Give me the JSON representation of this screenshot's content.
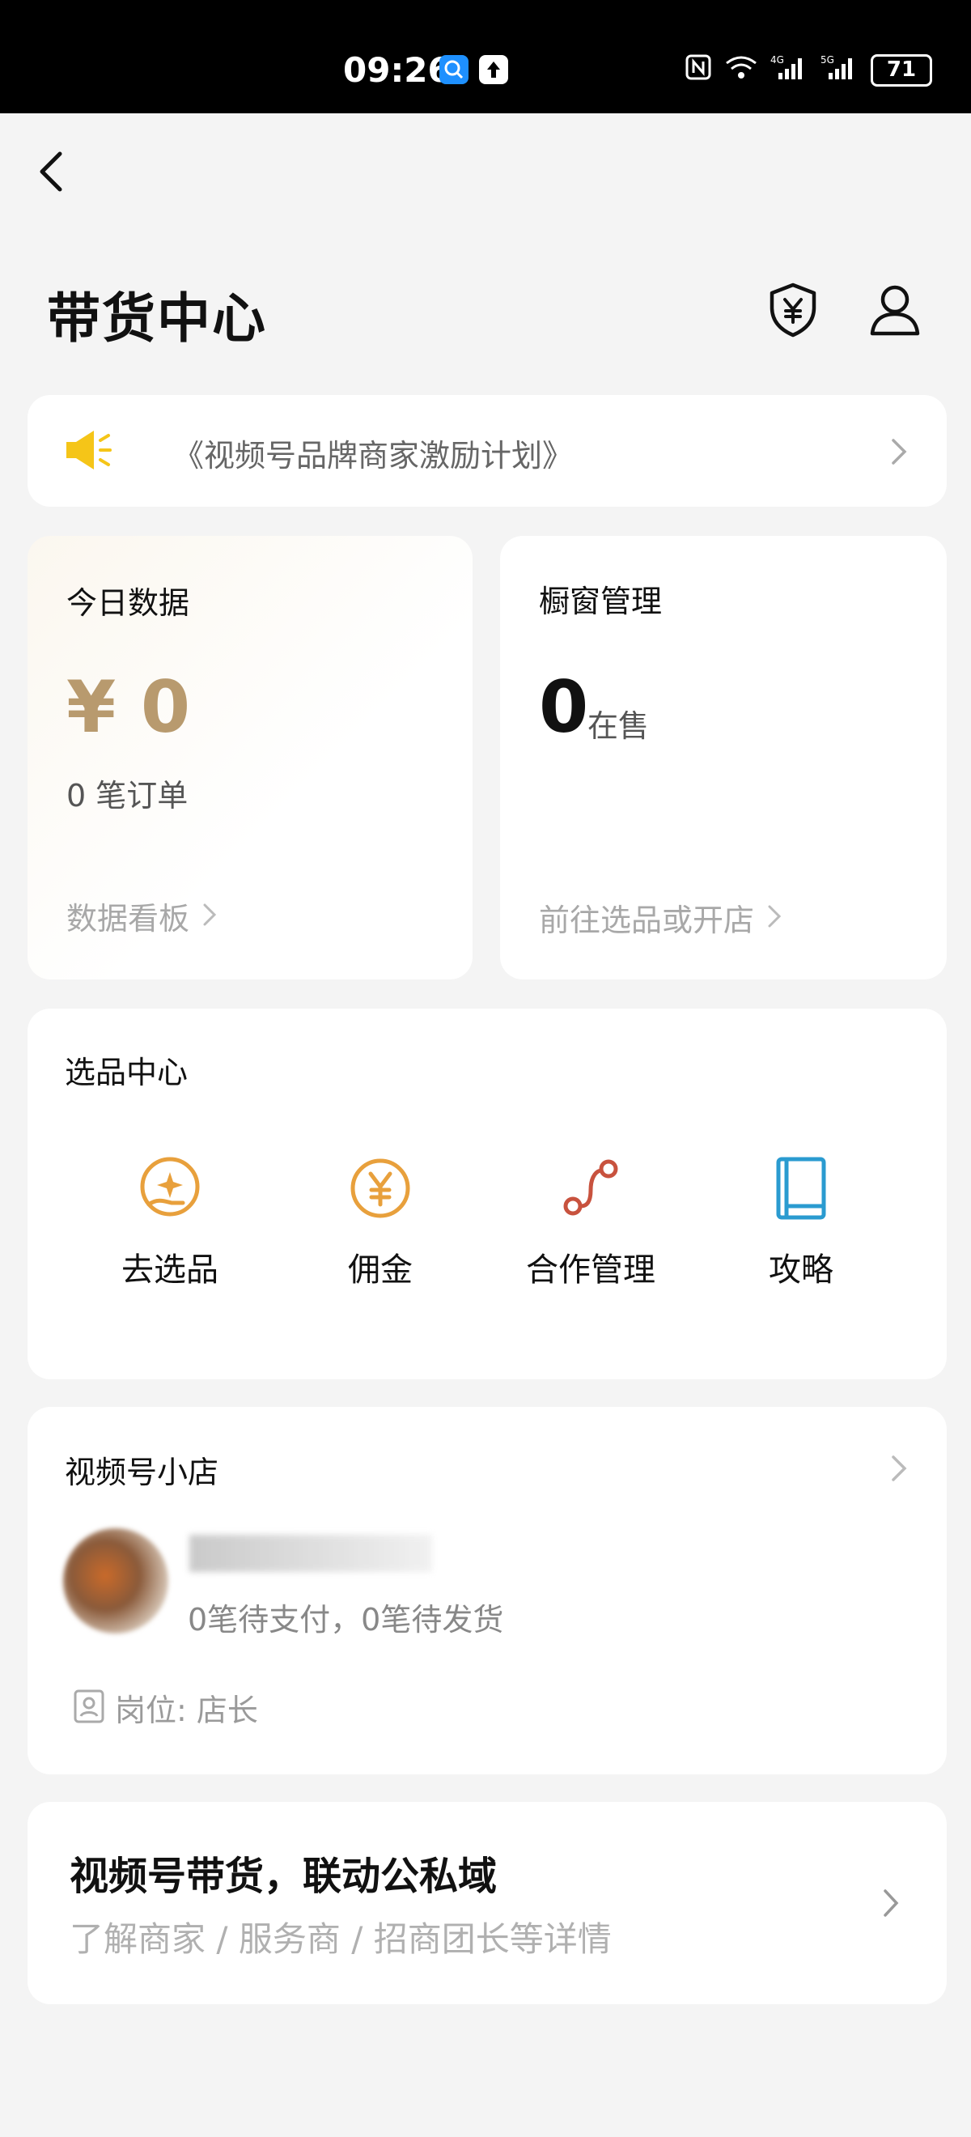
{
  "status_bar": {
    "time": "09:26",
    "battery": "71"
  },
  "header": {
    "title": "带货中心"
  },
  "notice": {
    "text": "《视频号品牌商家激励计划》"
  },
  "today": {
    "title": "今日数据",
    "amount": "¥ 0",
    "orders": "0 笔订单",
    "link": "数据看板"
  },
  "showcase": {
    "title": "橱窗管理",
    "count": "0",
    "count_label": "在售",
    "link": "前往选品或开店"
  },
  "select_center": {
    "title": "选品中心",
    "tools": [
      {
        "label": "去选品",
        "icon": "sparkle-hand-icon"
      },
      {
        "label": "佣金",
        "icon": "yen-circle-icon"
      },
      {
        "label": "合作管理",
        "icon": "route-icon"
      },
      {
        "label": "攻略",
        "icon": "book-icon"
      }
    ]
  },
  "shop": {
    "title": "视频号小店",
    "status": "0笔待支付，0笔待发货",
    "role": "岗位: 店长"
  },
  "promo": {
    "title": "视频号带货，联动公私域",
    "subtitle": "了解商家 / 服务商 / 招商团长等详情"
  },
  "colors": {
    "accent_gold": "#b89a6e",
    "orange": "#e8a03c",
    "teal": "#2a9bd0",
    "red": "#c8523e"
  }
}
